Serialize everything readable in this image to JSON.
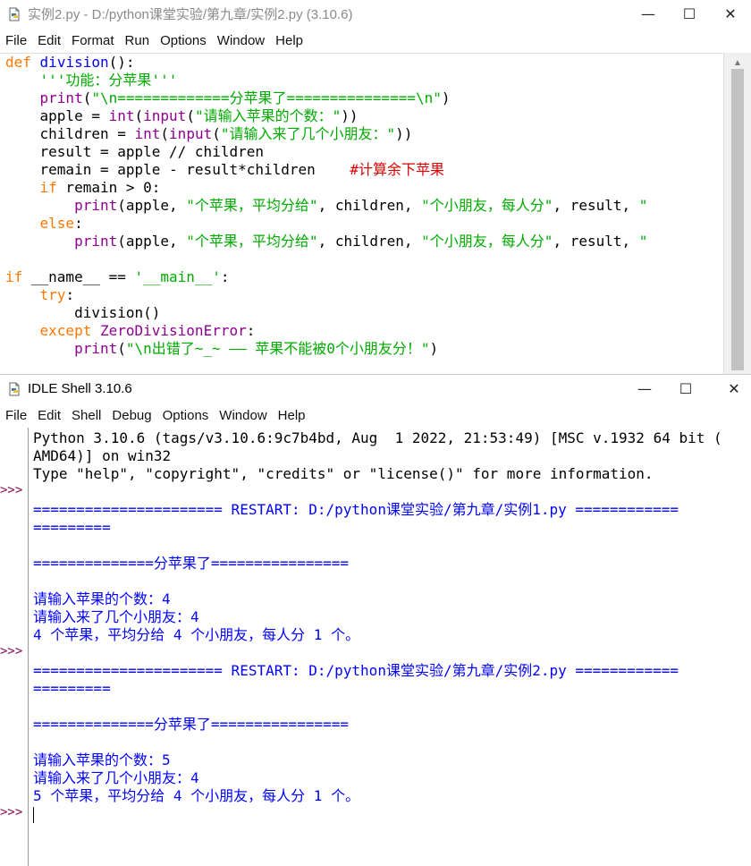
{
  "editor": {
    "title": "实例2.py - D:/python课堂实验/第九章/实例2.py (3.10.6)",
    "controls": {
      "minimize": "—",
      "maximize": "☐",
      "close": "✕"
    },
    "menu": [
      "File",
      "Edit",
      "Format",
      "Run",
      "Options",
      "Window",
      "Help"
    ],
    "lines": [
      [
        {
          "t": "def",
          "c": "kw"
        },
        {
          "t": " "
        },
        {
          "t": "division",
          "c": "def"
        },
        {
          "t": "():"
        }
      ],
      [
        {
          "t": "    "
        },
        {
          "t": "'''功能：分苹果'''",
          "c": "str"
        }
      ],
      [
        {
          "t": "    "
        },
        {
          "t": "print",
          "c": "bi"
        },
        {
          "t": "("
        },
        {
          "t": "\"\\n=============分苹果了===============\\n\"",
          "c": "str"
        },
        {
          "t": ")"
        }
      ],
      [
        {
          "t": "    apple = "
        },
        {
          "t": "int",
          "c": "bi"
        },
        {
          "t": "("
        },
        {
          "t": "input",
          "c": "bi"
        },
        {
          "t": "("
        },
        {
          "t": "\"请输入苹果的个数：\"",
          "c": "str"
        },
        {
          "t": "))"
        }
      ],
      [
        {
          "t": "    children = "
        },
        {
          "t": "int",
          "c": "bi"
        },
        {
          "t": "("
        },
        {
          "t": "input",
          "c": "bi"
        },
        {
          "t": "("
        },
        {
          "t": "\"请输入来了几个小朋友：\"",
          "c": "str"
        },
        {
          "t": "))"
        }
      ],
      [
        {
          "t": "    result = apple // children"
        }
      ],
      [
        {
          "t": "    remain = apple - result*children    "
        },
        {
          "t": "#计算余下苹果",
          "c": "com"
        }
      ],
      [
        {
          "t": "    "
        },
        {
          "t": "if",
          "c": "kw"
        },
        {
          "t": " remain > 0:"
        }
      ],
      [
        {
          "t": "        "
        },
        {
          "t": "print",
          "c": "bi"
        },
        {
          "t": "(apple, "
        },
        {
          "t": "\"个苹果，平均分给\"",
          "c": "str"
        },
        {
          "t": ", children, "
        },
        {
          "t": "\"个小朋友，每人分\"",
          "c": "str"
        },
        {
          "t": ", result, "
        },
        {
          "t": "\"",
          "c": "str"
        }
      ],
      [
        {
          "t": "    "
        },
        {
          "t": "else",
          "c": "kw"
        },
        {
          "t": ":"
        }
      ],
      [
        {
          "t": "        "
        },
        {
          "t": "print",
          "c": "bi"
        },
        {
          "t": "(apple, "
        },
        {
          "t": "\"个苹果，平均分给\"",
          "c": "str"
        },
        {
          "t": ", children, "
        },
        {
          "t": "\"个小朋友，每人分\"",
          "c": "str"
        },
        {
          "t": ", result, "
        },
        {
          "t": "\"",
          "c": "str"
        }
      ],
      [
        {
          "t": ""
        }
      ],
      [
        {
          "t": "if",
          "c": "kw"
        },
        {
          "t": " __name__ == "
        },
        {
          "t": "'__main__'",
          "c": "str"
        },
        {
          "t": ":"
        }
      ],
      [
        {
          "t": "    "
        },
        {
          "t": "try",
          "c": "kw"
        },
        {
          "t": ":"
        }
      ],
      [
        {
          "t": "        division()"
        }
      ],
      [
        {
          "t": "    "
        },
        {
          "t": "except",
          "c": "kw"
        },
        {
          "t": " "
        },
        {
          "t": "ZeroDivisionError",
          "c": "bi"
        },
        {
          "t": ":"
        }
      ],
      [
        {
          "t": "        "
        },
        {
          "t": "print",
          "c": "bi"
        },
        {
          "t": "("
        },
        {
          "t": "\"\\n出错了~_~ —— 苹果不能被0个小朋友分！\"",
          "c": "str"
        },
        {
          "t": ")"
        }
      ]
    ]
  },
  "shell": {
    "title": "IDLE Shell 3.10.6",
    "controls": {
      "minimize": "—",
      "maximize": "☐",
      "close": "✕"
    },
    "menu": [
      "File",
      "Edit",
      "Shell",
      "Debug",
      "Options",
      "Window",
      "Help"
    ],
    "prompt": ">>>",
    "prompt_rows": [
      3,
      12,
      21
    ],
    "lines": [
      {
        "t": "Python 3.10.6 (tags/v3.10.6:9c7b4bd, Aug  1 2022, 21:53:49) [MSC v.1932 64 bit (",
        "c": "sys"
      },
      {
        "t": "AMD64)] on win32",
        "c": "sys"
      },
      {
        "t": "Type \"help\", \"copyright\", \"credits\" or \"license()\" for more information.",
        "c": "sys"
      },
      {
        "t": "",
        "c": "sys"
      },
      {
        "t": "====================== RESTART: D:/python课堂实验/第九章/实例1.py ============",
        "c": "out"
      },
      {
        "t": "=========",
        "c": "out"
      },
      {
        "t": "",
        "c": "sys"
      },
      {
        "t": "==============分苹果了================",
        "c": "out"
      },
      {
        "t": "",
        "c": "sys"
      },
      {
        "t": "请输入苹果的个数：4",
        "c": "out"
      },
      {
        "t": "请输入来了几个小朋友：4",
        "c": "out"
      },
      {
        "t": "4 个苹果，平均分给 4 个小朋友，每人分 1 个。",
        "c": "out"
      },
      {
        "t": "",
        "c": "sys"
      },
      {
        "t": "====================== RESTART: D:/python课堂实验/第九章/实例2.py ============",
        "c": "out"
      },
      {
        "t": "=========",
        "c": "out"
      },
      {
        "t": "",
        "c": "sys"
      },
      {
        "t": "==============分苹果了================",
        "c": "out"
      },
      {
        "t": "",
        "c": "sys"
      },
      {
        "t": "请输入苹果的个数：5",
        "c": "out"
      },
      {
        "t": "请输入来了几个小朋友：4",
        "c": "out"
      },
      {
        "t": "5 个苹果，平均分给 4 个小朋友，每人分 1 个。",
        "c": "out"
      },
      {
        "t": "",
        "c": "sys",
        "cursor": true
      }
    ]
  }
}
